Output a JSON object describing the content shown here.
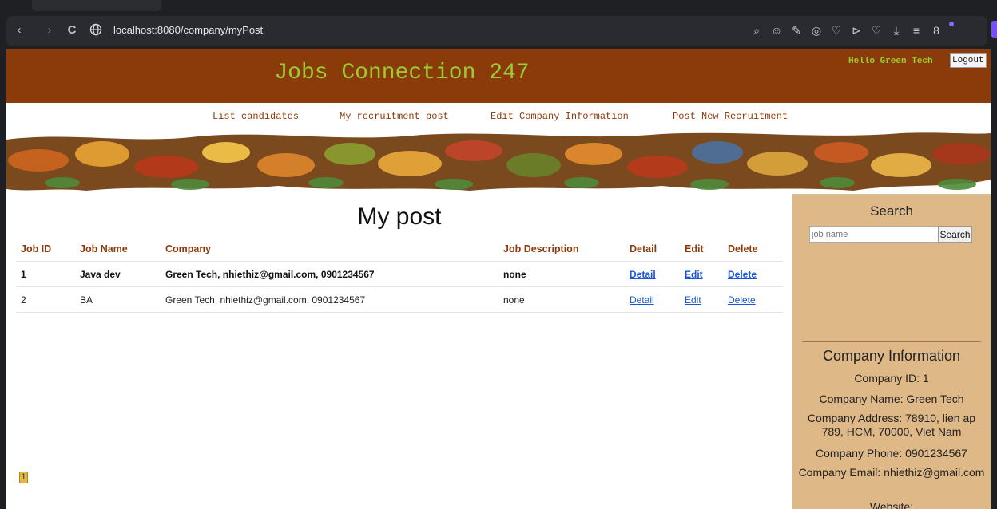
{
  "browser": {
    "url": "localhost:8080/company/myPost",
    "back": "‹",
    "forward": "›",
    "reload": "C",
    "icons": [
      "⌕",
      "☺",
      "✎",
      "◎",
      "♡",
      "⊳",
      "♡",
      "⤓",
      "≡",
      "8"
    ]
  },
  "header": {
    "site_title": "Jobs Connection 247",
    "greeting": "Hello Green Tech",
    "logout_label": "Logout"
  },
  "menu": {
    "items": [
      {
        "label": "List candidates"
      },
      {
        "label": "My recruitment post"
      },
      {
        "label": "Edit Company Information"
      },
      {
        "label": "Post New Recruitment"
      }
    ]
  },
  "main": {
    "title": "My post",
    "columns": [
      "Job ID",
      "Job Name",
      "Company",
      "Job Description",
      "Detail",
      "Edit",
      "Delete"
    ],
    "rows": [
      {
        "id": "1",
        "name": "Java dev",
        "company": "Green Tech, nhiethiz@gmail.com, 0901234567",
        "description": "none",
        "detail": "Detail",
        "edit": "Edit",
        "delete": "Delete"
      },
      {
        "id": "2",
        "name": "BA",
        "company": "Green Tech, nhiethiz@gmail.com, 0901234567",
        "description": "none",
        "detail": "Detail",
        "edit": "Edit",
        "delete": "Delete"
      }
    ],
    "page": "1"
  },
  "sidebar": {
    "search_title": "Search",
    "search_placeholder": "job name",
    "search_button": "Search",
    "info_title": "Company Information",
    "company_id": "Company ID: 1",
    "company_name": "Company Name: Green Tech",
    "company_address": "Company Address: 78910, lien ap 789, HCM, 70000, Viet Nam",
    "company_phone": "Company Phone: 0901234567",
    "company_email": "Company Email: nhiethiz@gmail.com",
    "website": "Website:"
  },
  "colors": {
    "header_bg": "#8b3a0a",
    "title_green": "#9acd32",
    "sidebar_bg": "#deb887",
    "link_blue": "#1a56d6"
  }
}
